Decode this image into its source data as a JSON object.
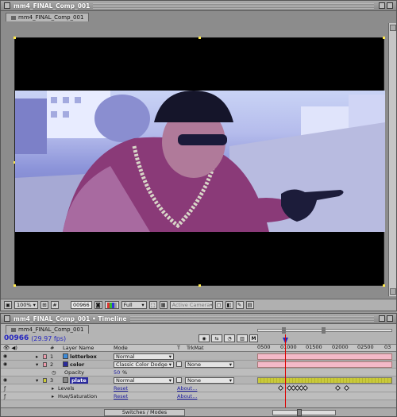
{
  "comp_window": {
    "title": "mm4_FINAL_Comp_001",
    "tab_label": "mm4_FINAL_Comp_001",
    "zoom": "100%",
    "timecode": "00966",
    "resolution": "Full",
    "camera": "Active Camera"
  },
  "timeline": {
    "title": "mm4_FINAL_Comp_001 • Timeline",
    "tab_label": "mm4_FINAL_Comp_001",
    "timecode": "00966",
    "fps": "(29.97 fps)",
    "m_button": "M",
    "ruler_labels": [
      "0500",
      "01000",
      "01500",
      "02000",
      "02500",
      "03"
    ],
    "headers": {
      "hash": "#",
      "layer_name": "Layer Name",
      "mode": "Mode",
      "t": "T",
      "trkmat": "TrkMat"
    },
    "layers": [
      {
        "num": "1",
        "name": "letterbox",
        "mode": "Normal",
        "trkmat": "",
        "color": "#3c8ad8"
      },
      {
        "num": "2",
        "name": "color",
        "mode": "Classic Color Dodge",
        "trkmat": "None",
        "color": "#2a2a9c"
      },
      {
        "num": "3",
        "name": "plate",
        "mode": "Normal",
        "trkmat": "None",
        "color": "#cccc33"
      }
    ],
    "opacity": {
      "label": "Opacity",
      "value": "50",
      "unit": "%"
    },
    "effects": [
      {
        "name": "Levels",
        "reset": "Reset",
        "about": "About..."
      },
      {
        "name": "Hue/Saturation",
        "reset": "Reset",
        "about": "About..."
      }
    ],
    "switches_label": "Switches / Modes",
    "colors": {
      "timecode": "#2525c0",
      "layer_bar_pink": "#f3b9c8",
      "layer_bar_yellow": "#c9c93b",
      "playhead": "#dd0000"
    }
  }
}
